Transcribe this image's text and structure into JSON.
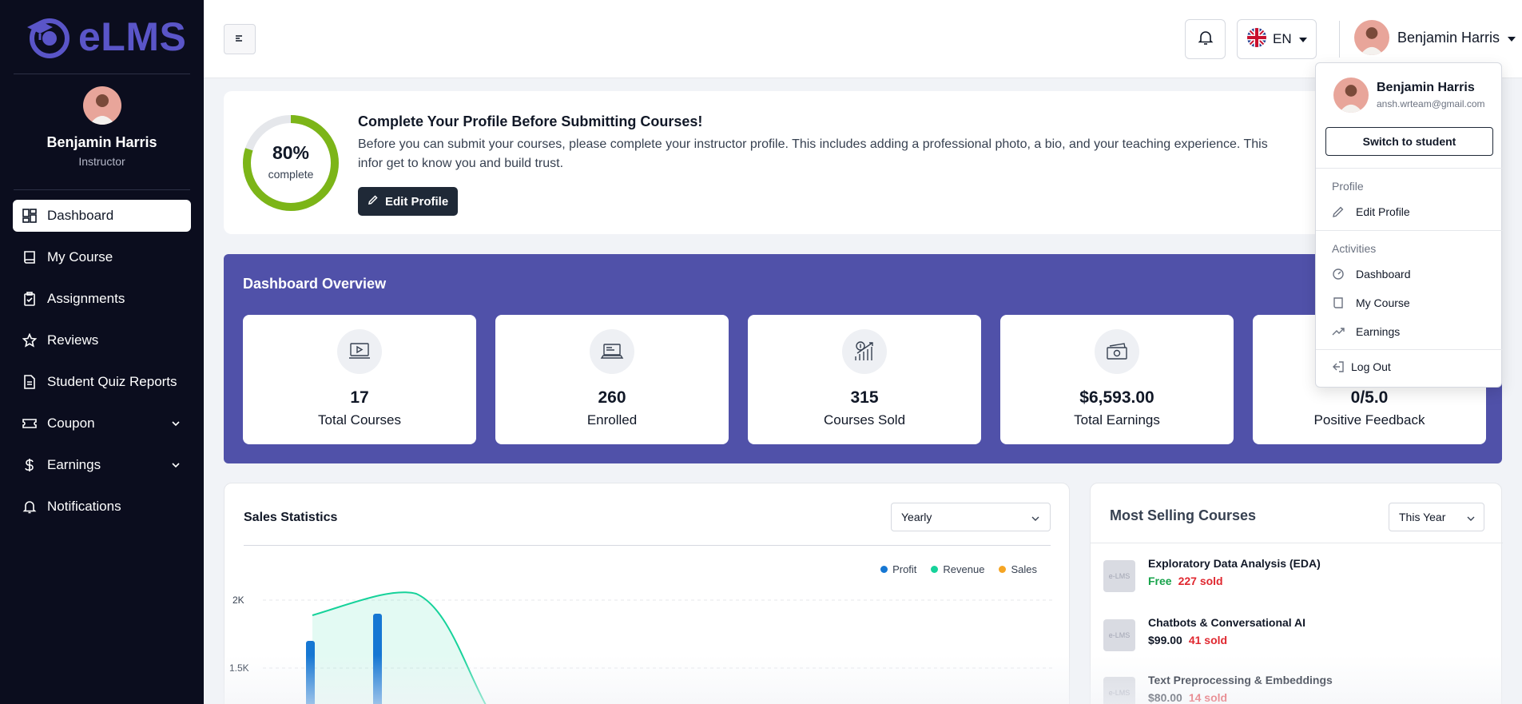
{
  "brand": {
    "name": "eLMS",
    "color": "#5a55c8"
  },
  "sidebar": {
    "user_name": "Benjamin Harris",
    "user_role": "Instructor",
    "items": [
      {
        "label": "Dashboard",
        "icon": "dashboard-icon",
        "active": true
      },
      {
        "label": "My Course",
        "icon": "book-icon"
      },
      {
        "label": "Assignments",
        "icon": "clipboard-icon"
      },
      {
        "label": "Reviews",
        "icon": "star-icon"
      },
      {
        "label": "Student Quiz Reports",
        "icon": "report-icon"
      },
      {
        "label": "Coupon",
        "icon": "ticket-icon",
        "expandable": true
      },
      {
        "label": "Earnings",
        "icon": "dollar-icon",
        "expandable": true
      },
      {
        "label": "Notifications",
        "icon": "bell-icon"
      }
    ]
  },
  "topbar": {
    "language": "EN",
    "user_name": "Benjamin Harris"
  },
  "profile_card": {
    "percent_value": 0.8,
    "percent": "80%",
    "percent_label": "complete",
    "title": "Complete Your Profile Before Submitting Courses!",
    "description": "Before you can submit your courses, please complete your instructor profile. This includes adding a professional photo, a bio, and your teaching experience. This infor get to know you and build trust.",
    "edit_label": "Edit Profile"
  },
  "overview": {
    "title": "Dashboard Overview",
    "stats": [
      {
        "value": "17",
        "label": "Total Courses",
        "icon": "video-course-icon"
      },
      {
        "value": "260",
        "label": "Enrolled",
        "icon": "laptop-icon"
      },
      {
        "value": "315",
        "label": "Courses Sold",
        "icon": "growth-chart-icon"
      },
      {
        "value": "$6,593.00",
        "label": "Total Earnings",
        "icon": "cash-icon"
      },
      {
        "value": "0/5.0",
        "label": "Positive Feedback",
        "icon": "feedback-icon"
      }
    ]
  },
  "sales": {
    "title": "Sales Statistics",
    "period": "Yearly"
  },
  "chart_data": {
    "type": "bar",
    "series": [
      {
        "name": "Profit",
        "color": "#1677d3",
        "values": [
          1700,
          1900,
          null,
          0
        ]
      },
      {
        "name": "Revenue",
        "color": "#16d29a"
      },
      {
        "name": "Sales",
        "color": "#f5a524"
      }
    ],
    "y_ticks": [
      "2K",
      "1.5K"
    ],
    "ylim": [
      0,
      2000
    ],
    "legend": "top-right"
  },
  "most_selling": {
    "title": "Most Selling Courses",
    "period": "This Year",
    "thumb_text": "e-LMS",
    "courses": [
      {
        "name": "Exploratory Data Analysis (EDA)",
        "price": "Free",
        "sold": "227 sold",
        "free": true
      },
      {
        "name": "Chatbots & Conversational AI",
        "price": "$99.00",
        "sold": "41 sold"
      },
      {
        "name": "Text Preprocessing & Embeddings",
        "price": "$80.00",
        "sold": "14 sold"
      }
    ]
  },
  "dropdown": {
    "name": "Benjamin Harris",
    "email": "ansh.wrteam@gmail.com",
    "switch_label": "Switch to student",
    "profile_heading": "Profile",
    "edit_profile": "Edit Profile",
    "activities_heading": "Activities",
    "dashboard": "Dashboard",
    "my_course": "My Course",
    "earnings": "Earnings",
    "logout": "Log Out"
  }
}
